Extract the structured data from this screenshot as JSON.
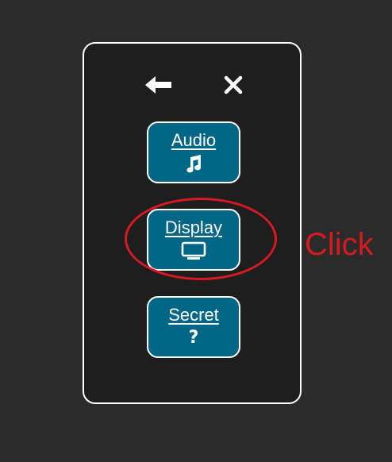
{
  "colors": {
    "background": "#2b2b2b",
    "panel": "#1e1e1e",
    "button_fill": "#006685",
    "border": "#ffffff",
    "annotation": "#d71920"
  },
  "header": {
    "back_icon": "arrow-left-icon",
    "close_icon": "close-icon"
  },
  "menu": {
    "items": [
      {
        "label": "Audio",
        "icon": "music-note-icon"
      },
      {
        "label": "Display",
        "icon": "monitor-icon"
      },
      {
        "label": "Secret",
        "icon": "question-mark-icon",
        "glyph": "?"
      }
    ]
  },
  "annotation": {
    "text": "Click",
    "target": "Display"
  }
}
